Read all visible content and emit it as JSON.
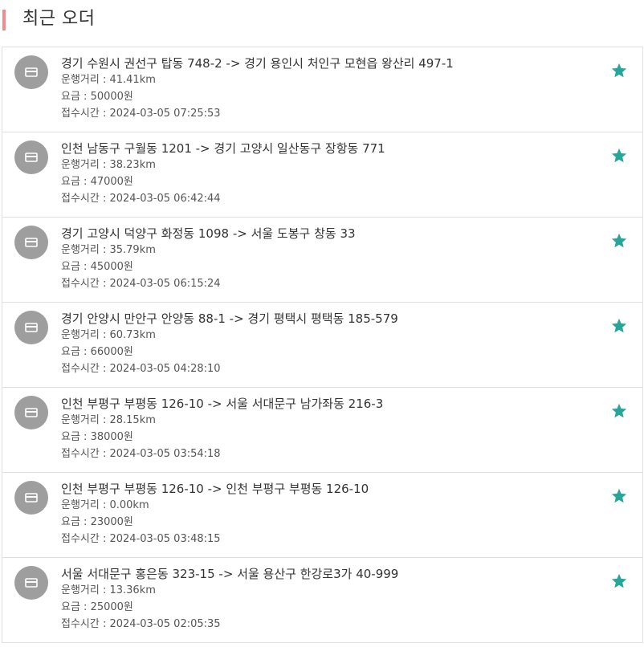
{
  "header": {
    "title": "최근 오더",
    "accent_color": "#f28b8b"
  },
  "colors": {
    "star": "#26a69a",
    "avatar_bg": "#9e9e9e"
  },
  "orders": [
    {
      "route": "경기 수원시 권선구 탑동 748-2 -> 경기 용인시 처인구 모현읍 왕산리 497-1",
      "distance": "운행거리 : 41.41km",
      "fare": "요금 : 50000원",
      "time": "접수시간 : 2024-03-05 07:25:53",
      "icon": "card-icon",
      "favorite_icon": "star-icon"
    },
    {
      "route": "인천 남동구 구월동 1201 -> 경기 고양시 일산동구 장항동 771",
      "distance": "운행거리 : 38.23km",
      "fare": "요금 : 47000원",
      "time": "접수시간 : 2024-03-05 06:42:44",
      "icon": "card-icon",
      "favorite_icon": "star-icon"
    },
    {
      "route": "경기 고양시 덕양구 화정동 1098 -> 서울 도봉구 창동 33",
      "distance": "운행거리 : 35.79km",
      "fare": "요금 : 45000원",
      "time": "접수시간 : 2024-03-05 06:15:24",
      "icon": "card-icon",
      "favorite_icon": "star-icon"
    },
    {
      "route": "경기 안양시 만안구 안양동 88-1 -> 경기 평택시 평택동 185-579",
      "distance": "운행거리 : 60.73km",
      "fare": "요금 : 66000원",
      "time": "접수시간 : 2024-03-05 04:28:10",
      "icon": "card-icon",
      "favorite_icon": "star-icon"
    },
    {
      "route": "인천 부평구 부평동 126-10 -> 서울 서대문구 남가좌동 216-3",
      "distance": "운행거리 : 28.15km",
      "fare": "요금 : 38000원",
      "time": "접수시간 : 2024-03-05 03:54:18",
      "icon": "card-icon",
      "favorite_icon": "star-icon"
    },
    {
      "route": "인천 부평구 부평동 126-10 -> 인천 부평구 부평동 126-10",
      "distance": "운행거리 : 0.00km",
      "fare": "요금 : 23000원",
      "time": "접수시간 : 2024-03-05 03:48:15",
      "icon": "card-icon",
      "favorite_icon": "star-icon"
    },
    {
      "route": "서울 서대문구 홍은동 323-15 -> 서울 용산구 한강로3가 40-999",
      "distance": "운행거리 : 13.36km",
      "fare": "요금 : 25000원",
      "time": "접수시간 : 2024-03-05 02:05:35",
      "icon": "card-icon",
      "favorite_icon": "star-icon"
    }
  ]
}
